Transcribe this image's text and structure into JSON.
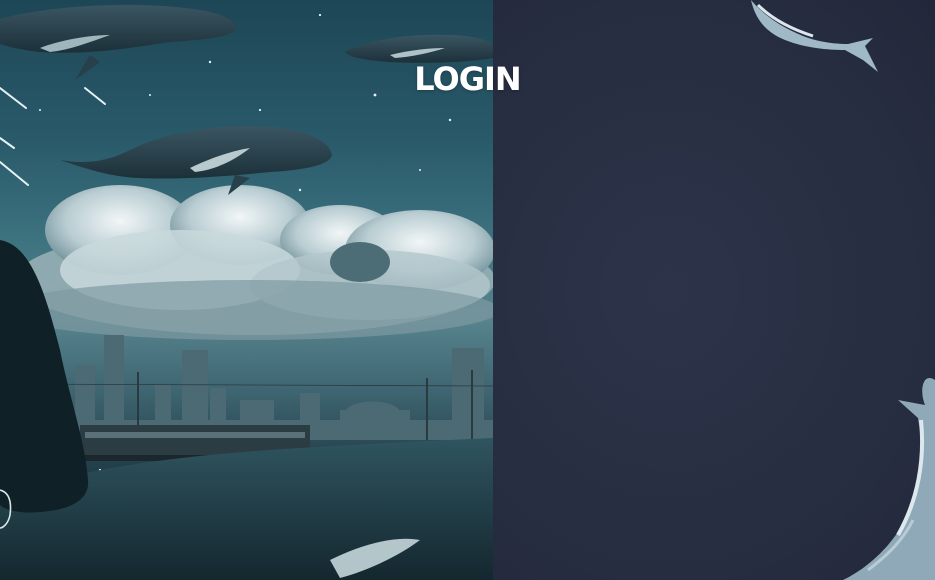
{
  "page": {
    "title": "LOGIN"
  },
  "artwork": {
    "left_scene": "whales-over-city-illustration",
    "right_decor": "whale-illustration"
  },
  "colors": {
    "right_panel": "#272d40",
    "title_text": "#ffffff",
    "sky_teal": "#2a5b6b"
  }
}
